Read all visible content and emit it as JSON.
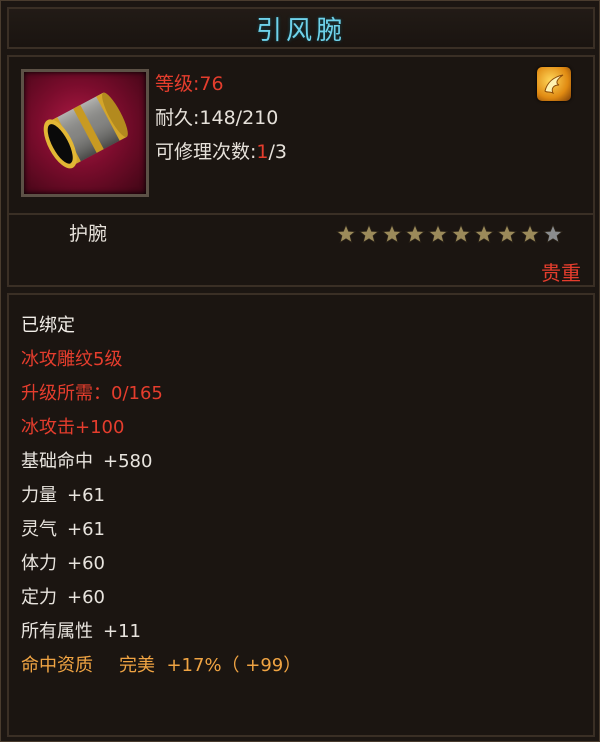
{
  "item": {
    "name": "引风腕",
    "level_label": "等级",
    "level_value": ":76",
    "durability_label": "耐久",
    "durability_value": ":148/210",
    "repair_label": "可修理次数",
    "repair_current": "1",
    "repair_total": "/3",
    "type": "护腕",
    "stars_filled": 9,
    "stars_total": 10,
    "quality": "贵重",
    "icon": "bracer-icon",
    "badge_icon": "phoenix-emblem-icon"
  },
  "details": {
    "bound": "已绑定",
    "engraving": "冰攻雕纹5级",
    "upgrade_required": "升级所需：0/165",
    "ice_attack": "冰攻击+100",
    "attributes": [
      {
        "name": "基础命中",
        "value": "+580"
      },
      {
        "name": "力量",
        "value": "+61"
      },
      {
        "name": "灵气",
        "value": "+61"
      },
      {
        "name": "体力",
        "value": "+60"
      },
      {
        "name": "定力",
        "value": "+60"
      },
      {
        "name": "所有属性",
        "value": "+11"
      }
    ],
    "aptitude": {
      "name": "命中资质",
      "grade": "完美",
      "value": "+17%（ +99）"
    }
  },
  "colors": {
    "title": "#6fd2ea",
    "red": "#e53d2d",
    "orange": "#f0a443",
    "star_filled": "#9b8a5a",
    "star_empty": "#8a8c8e"
  }
}
